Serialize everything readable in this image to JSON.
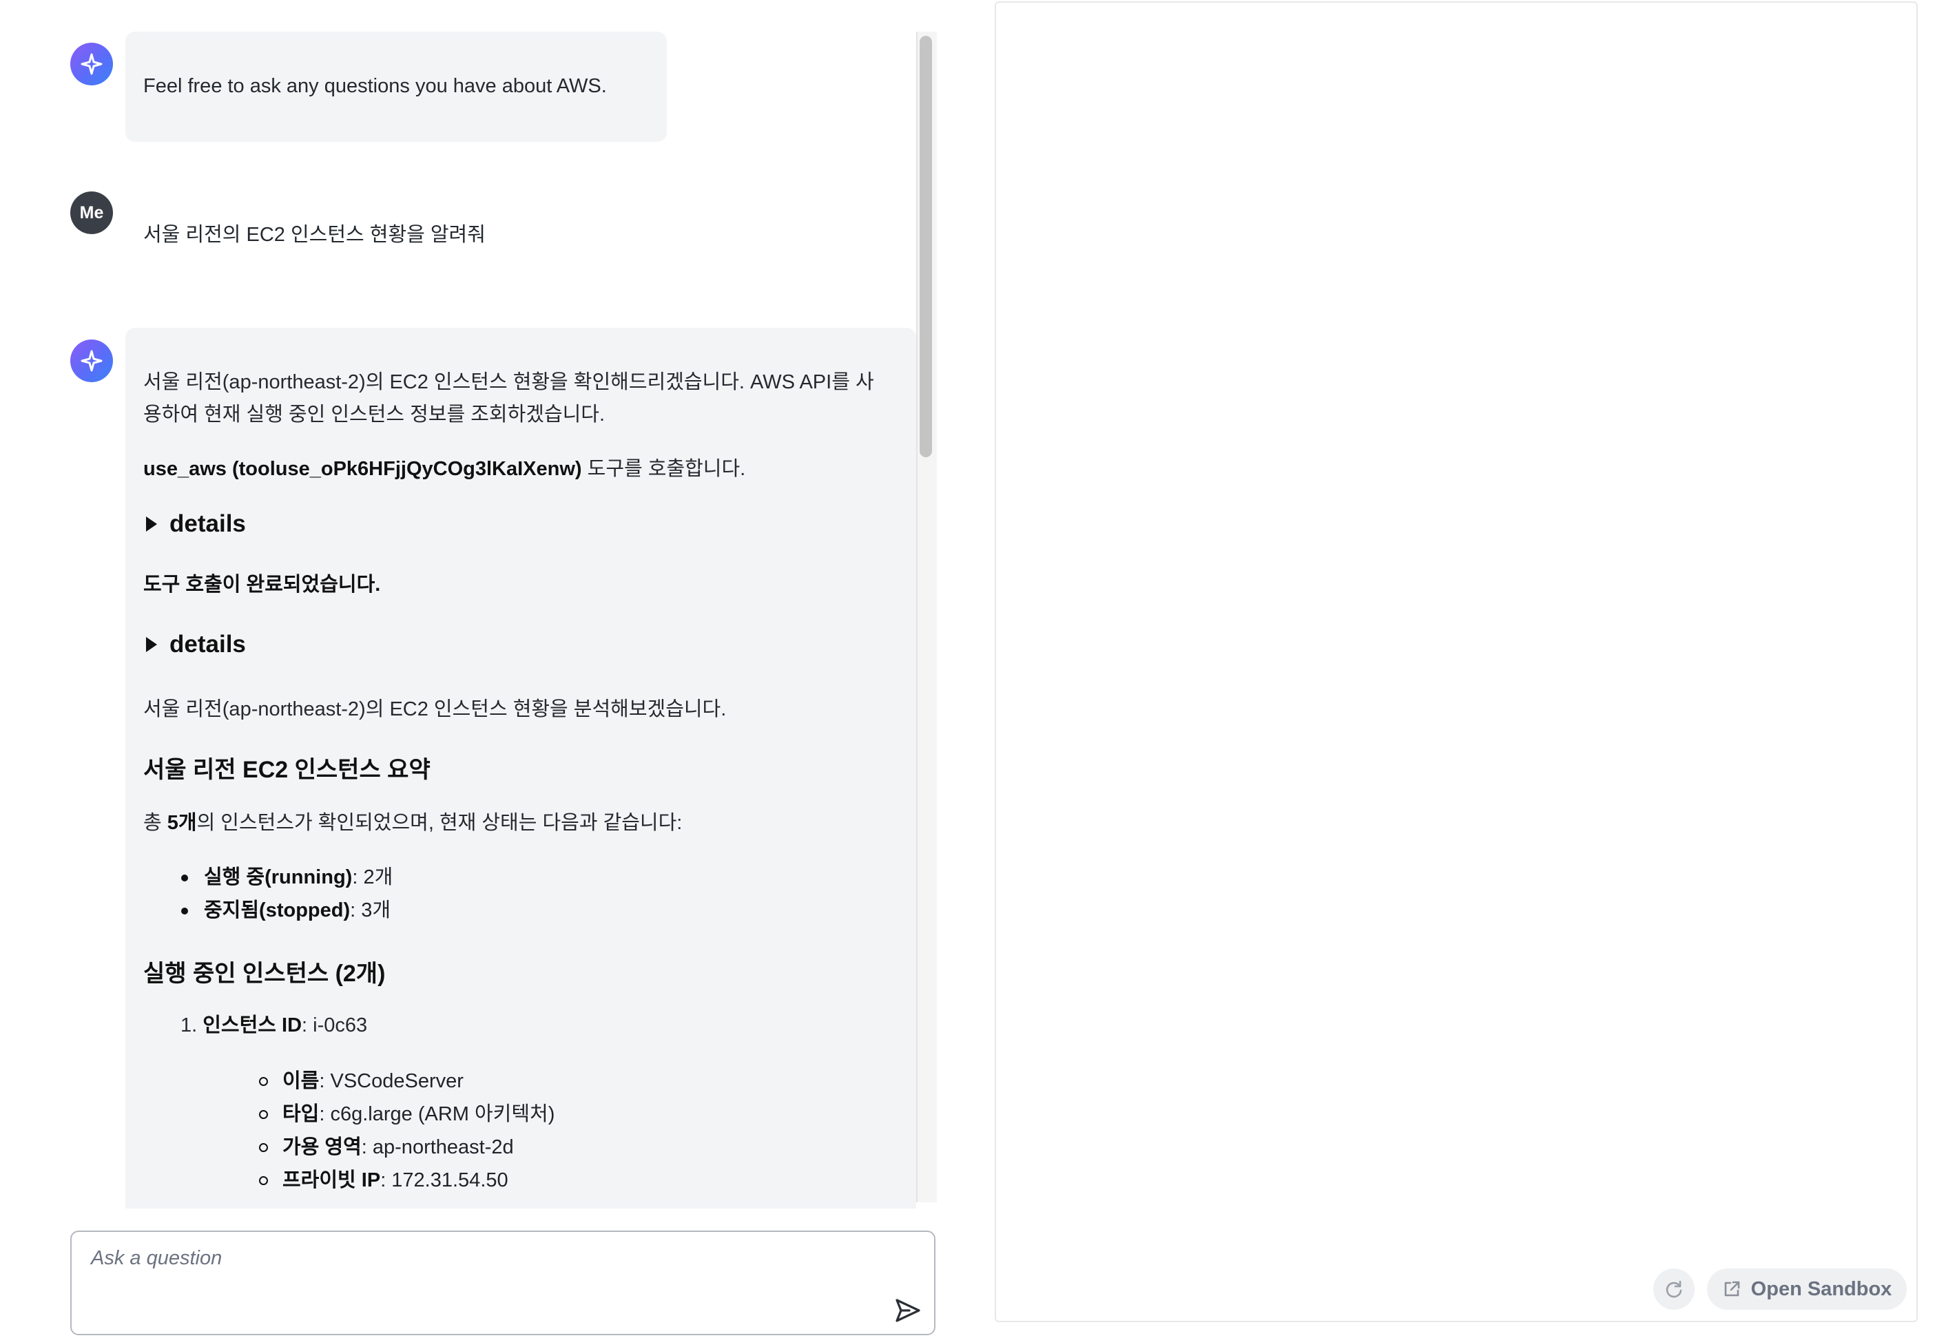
{
  "chat": {
    "greeting": "Feel free to ask any questions you have about AWS.",
    "user_avatar": "Me",
    "user_message": "서울 리전의 EC2 인스턴스 현황을 알려줘",
    "assistant": {
      "intro_line1": "서울 리전(ap-northeast-2)의 EC2 인스턴스 현황을 확인해드리겠습니다. AWS API를 사",
      "intro_line2": "용하여 현재 실행 중인 인스턴스 정보를 조회하겠습니다.",
      "tool_call_bold": "use_aws (tooluse_oPk6HFjjQyCOg3lKaIXenw)",
      "tool_call_rest": " 도구를 호출합니다.",
      "details_label": "details",
      "tool_done": "도구 호출이 완료되었습니다.",
      "details_label_2": "details",
      "analysis_line": "서울 리전(ap-northeast-2)의 EC2 인스턴스 현황을 분석해보겠습니다.",
      "summary_heading": "서울 리전 EC2 인스턴스 요약",
      "total_prefix": "총 ",
      "total_bold": "5개",
      "total_suffix": "의 인스턴스가 확인되었으며, 현재 상태는 다음과 같습니다:",
      "status_items": [
        {
          "label": "실행 중(running)",
          "value": ": 2개"
        },
        {
          "label": "중지됨(stopped)",
          "value": ": 3개"
        }
      ],
      "running_heading": "실행 중인 인스턴스 (2개)",
      "instance_number": "1.",
      "instance_id_label": "인스턴스 ID",
      "instance_id_value": ": i-0c63",
      "instance_details": [
        {
          "label": "이름",
          "value": ": VSCodeServer"
        },
        {
          "label": "타입",
          "value": ": c6g.large (ARM 아키텍처)"
        },
        {
          "label": "가용 영역",
          "value": ": ap-northeast-2d"
        },
        {
          "label": "프라이빗 IP",
          "value": ": 172.31.54.50"
        }
      ]
    }
  },
  "input": {
    "placeholder": "Ask a question"
  },
  "preview_panel": {
    "open_sandbox_label": "Open Sandbox"
  },
  "icons": {
    "assistant_avatar": "sparkle-icon",
    "send": "send-icon",
    "refresh": "refresh-icon",
    "external_link": "external-link-icon"
  },
  "colors": {
    "assistant_avatar_gradient_start": "#8b5cf6",
    "assistant_avatar_gradient_end": "#3b82f6",
    "user_avatar": "#3a3f47",
    "bubble_background": "#f3f4f6"
  }
}
